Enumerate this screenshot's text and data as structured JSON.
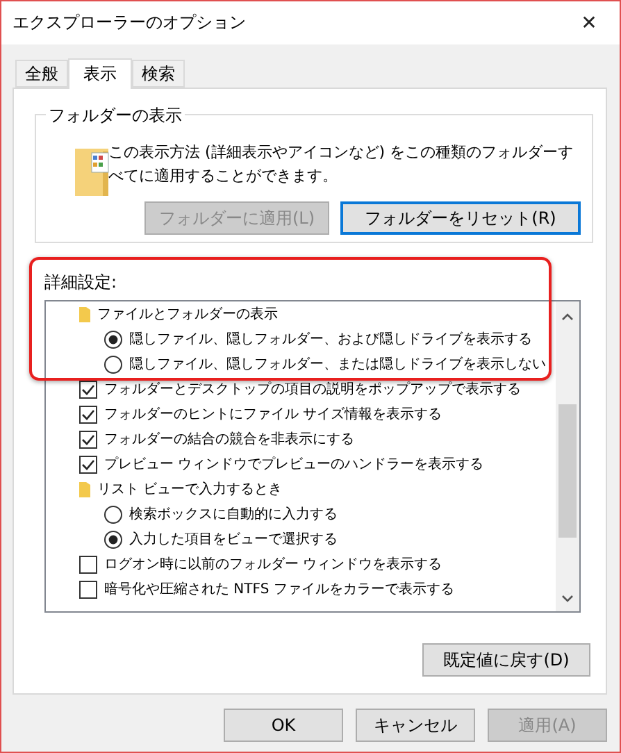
{
  "window": {
    "title": "エクスプローラーのオプション",
    "close": "✕"
  },
  "tabs": [
    {
      "label": "全般",
      "selected": false
    },
    {
      "label": "表示",
      "selected": true
    },
    {
      "label": "検索",
      "selected": false
    }
  ],
  "folder_view": {
    "title": "フォルダーの表示",
    "text": "この表示方法 (詳細表示やアイコンなど) をこの種類のフォルダーすべてに適用することができます。",
    "buttons": [
      {
        "label": "フォルダーに適用(L)",
        "disabled": true,
        "focused": false
      },
      {
        "label": "フォルダーをリセット(R)",
        "disabled": false,
        "focused": true
      }
    ]
  },
  "advanced": {
    "title": "詳細設定:",
    "highlighted": true,
    "items": [
      {
        "kind": "folder",
        "label": "ファイルとフォルダーの表示",
        "children": [
          {
            "kind": "radio",
            "label": "隠しファイル、隠しフォルダー、および隠しドライブを表示する",
            "selected": true
          },
          {
            "kind": "radio",
            "label": "隠しファイル、隠しフォルダー、または隠しドライブを表示しない",
            "selected": false
          }
        ]
      },
      {
        "kind": "check",
        "label": "フォルダーとデスクトップの項目の説明をポップアップで表示する",
        "checked": true
      },
      {
        "kind": "check",
        "label": "フォルダーのヒントにファイル サイズ情報を表示する",
        "checked": true
      },
      {
        "kind": "check",
        "label": "フォルダーの結合の競合を非表示にする",
        "checked": true
      },
      {
        "kind": "check",
        "label": "プレビュー ウィンドウでプレビューのハンドラーを表示する",
        "checked": true
      },
      {
        "kind": "folder",
        "label": "リスト ビューで入力するとき",
        "children": [
          {
            "kind": "radio",
            "label": "検索ボックスに自動的に入力する",
            "selected": false
          },
          {
            "kind": "radio",
            "label": "入力した項目をビューで選択する",
            "selected": true
          }
        ]
      },
      {
        "kind": "check",
        "label": "ログオン時に以前のフォルダー ウィンドウを表示する",
        "checked": false
      },
      {
        "kind": "check",
        "label": "暗号化や圧縮された NTFS ファイルをカラーで表示する",
        "checked": false
      }
    ],
    "restore_button": {
      "label": "既定値に戻す(D)"
    }
  },
  "buttons": [
    {
      "label": "OK",
      "disabled": false
    },
    {
      "label": "キャンセル",
      "disabled": false
    },
    {
      "label": "適用(A)",
      "disabled": true
    }
  ]
}
